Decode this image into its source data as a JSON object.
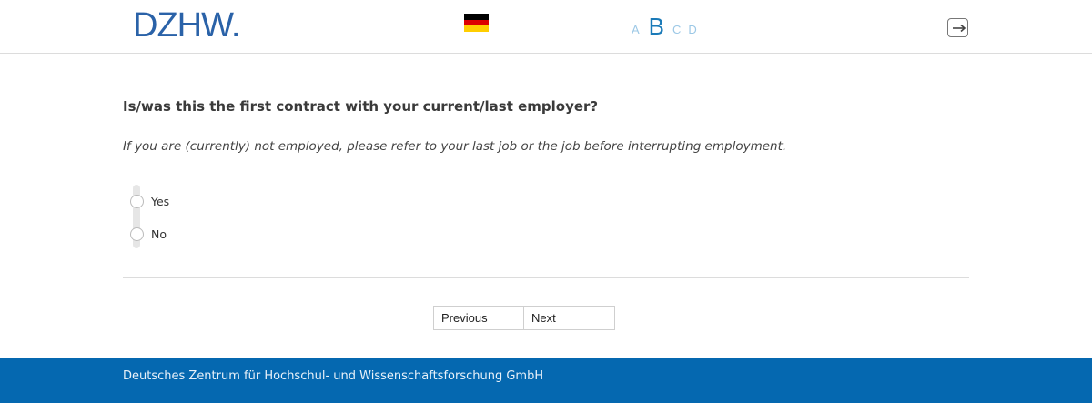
{
  "header": {
    "logo_text": "DZHW",
    "logo_dot": ".",
    "language_flag": "germany-flag-icon",
    "font_size_options": [
      "A",
      "B",
      "C",
      "D"
    ],
    "font_size_selected": "B",
    "exit_icon": "exit-icon"
  },
  "question": {
    "title": "Is/was this the first contract with your current/last employer?",
    "instruction": "If you are (currently) not employed, please refer to your last job or the job before interrupting employment.",
    "options": [
      {
        "label": "Yes"
      },
      {
        "label": "No"
      }
    ]
  },
  "navigation": {
    "previous_label": "Previous",
    "next_label": "Next"
  },
  "footer": {
    "text": "Deutsches Zentrum für Hochschul- und Wissenschaftsforschung GmbH"
  },
  "colors": {
    "brand_blue": "#2a62a8",
    "footer_blue": "#0568b0",
    "font_selected": "#1a7ab8",
    "font_unselected": "#9cc8e6"
  }
}
